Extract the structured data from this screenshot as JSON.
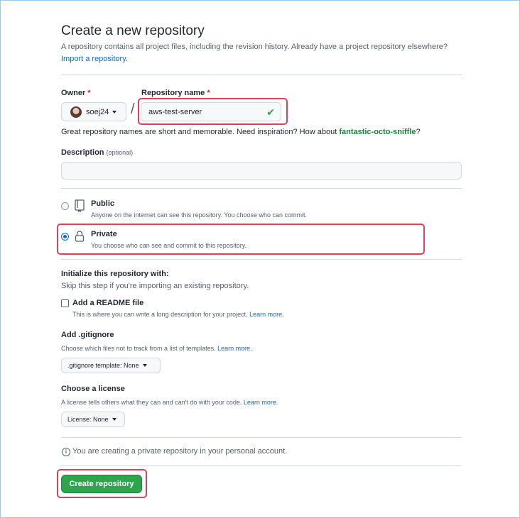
{
  "header": {
    "title": "Create a new repository",
    "subtitle": "A repository contains all project files, including the revision history. Already have a project repository elsewhere?",
    "import_link": "Import a repository."
  },
  "owner": {
    "label": "Owner",
    "required_mark": "*",
    "value": "soej24",
    "icon": "avatar"
  },
  "separator": "/",
  "repo_name": {
    "label": "Repository name",
    "required_mark": "*",
    "value": "aws-test-server",
    "status_icon": "check-icon"
  },
  "name_hint": {
    "text": "Great repository names are short and memorable. Need inspiration? How about ",
    "suggestion": "fantastic-octo-sniffle",
    "end": "?"
  },
  "description": {
    "label": "Description",
    "optional": "(optional)",
    "value": ""
  },
  "visibility": {
    "options": [
      {
        "title": "Public",
        "desc": "Anyone on the internet can see this repository. You choose who can commit.",
        "icon": "repo-icon",
        "selected": false
      },
      {
        "title": "Private",
        "desc": "You choose who can see and commit to this repository.",
        "icon": "lock-icon",
        "selected": true
      }
    ]
  },
  "init": {
    "title": "Initialize this repository with:",
    "subtitle": "Skip this step if you're importing an existing repository.",
    "readme_label": "Add a README file",
    "readme_desc": "This is where you can write a long description for your project.",
    "learn_more": "Learn more."
  },
  "gitignore": {
    "title": "Add .gitignore",
    "desc": "Choose which files not to track from a list of templates.",
    "learn_more": "Learn more.",
    "select_label": ".gitignore template: None"
  },
  "license": {
    "title": "Choose a license",
    "desc": "A license tells others what they can and can't do with your code.",
    "learn_more": "Learn more.",
    "select_label": "License: None"
  },
  "notice": {
    "icon": "info-icon",
    "text": "You are creating a private repository in your personal account."
  },
  "submit": {
    "label": "Create repository"
  },
  "colors": {
    "accent_green": "#2da44e",
    "link_blue": "#0969da",
    "highlight_red": "#d9435a"
  }
}
